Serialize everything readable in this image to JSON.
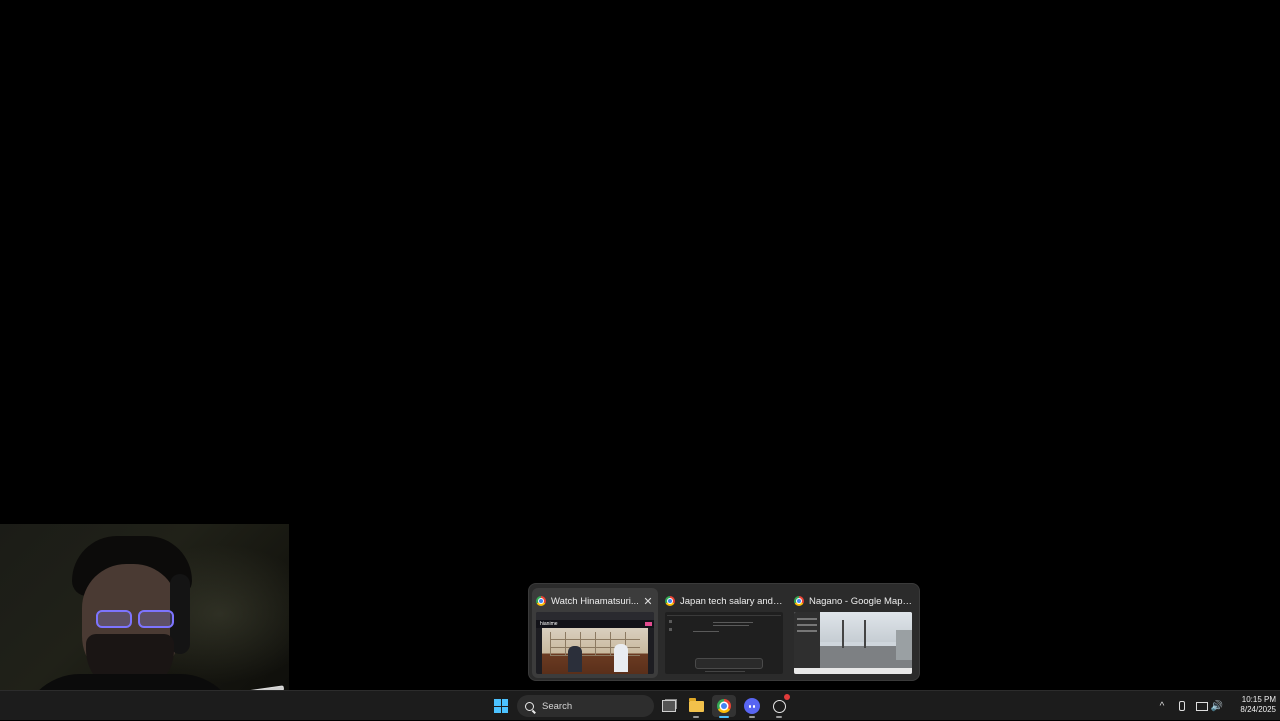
{
  "preview": {
    "windows": [
      {
        "title": "Watch Hinamatsuri...",
        "active": true,
        "close_glyph": "✕",
        "icon": "chrome-icon",
        "thumb_logo": "hianime"
      },
      {
        "title": "Japan tech salary and work...",
        "active": false,
        "icon": "chrome-icon"
      },
      {
        "title": "Nagano - Google Maps - G...",
        "active": false,
        "icon": "chrome-icon"
      }
    ]
  },
  "taskbar": {
    "start_icon": "windows-logo-icon",
    "search_label": "Search",
    "apps": [
      {
        "name": "task-view",
        "icon": "task-view-icon"
      },
      {
        "name": "file-explorer",
        "icon": "folder-icon"
      },
      {
        "name": "google-chrome",
        "icon": "chrome-icon",
        "active": true
      },
      {
        "name": "discord",
        "icon": "discord-icon"
      },
      {
        "name": "app-with-notification",
        "icon": "circle-app-icon"
      }
    ],
    "tray": {
      "chevron": "^",
      "volume_glyph": "🔊",
      "time": "10:15 PM",
      "date": "8/24/2025"
    },
    "accent": "#4cc2ff"
  },
  "colors": {
    "desktop": "#000000",
    "taskbar": "#1c1c1c",
    "popup": "#2b2b2b"
  }
}
